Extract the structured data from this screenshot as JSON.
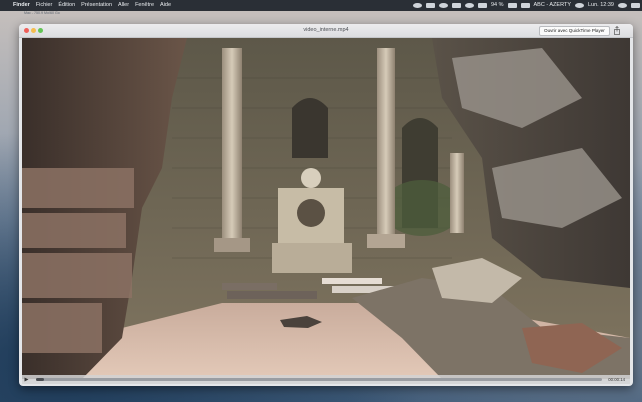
{
  "menubar": {
    "apple_glyph": "",
    "items": [
      "Finder",
      "Fichier",
      "Édition",
      "Présentation",
      "Aller",
      "Fenêtre",
      "Aide"
    ],
    "status": {
      "battery": "94 %",
      "keyboard": "ABC - AZERTY",
      "clock": "Lun. 12:39"
    }
  },
  "desktop": {
    "label": "Mac - 750.9 Mo/60 Go"
  },
  "window": {
    "title": "video_interne.mp4",
    "open_button_label": "Ouvrir avec QuickTime Player"
  },
  "player": {
    "time": "00:00:14",
    "progress": 0.015
  },
  "colors": {
    "menubar": "#2a2f36",
    "close": "#ee5f59",
    "minimize": "#f5bd4f",
    "maximize": "#62c454"
  }
}
